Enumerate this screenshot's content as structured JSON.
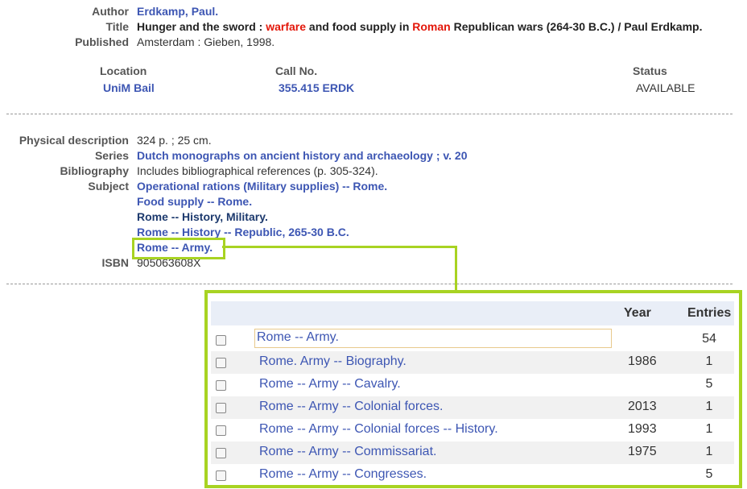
{
  "record": {
    "author_label": "Author",
    "author": "Erdkamp, Paul.",
    "title_label": "Title",
    "title_pre": "Hunger and the sword : ",
    "title_hl1": "warfare",
    "title_mid": " and food supply in ",
    "title_hl2": "Roman",
    "title_post": " Republican wars (264-30 B.C.) / Paul Erdkamp.",
    "published_label": "Published",
    "published": "Amsterdam : Gieben, 1998."
  },
  "holdings": {
    "location_header": "Location",
    "callno_header": "Call No.",
    "status_header": "Status",
    "location": "UniM Bail",
    "callno": "355.415 ERDK",
    "status": "AVAILABLE"
  },
  "details": {
    "physical_label": "Physical description",
    "physical": "324 p. ; 25 cm.",
    "series_label": "Series",
    "series": "Dutch monographs on ancient history and archaeology ; v. 20",
    "bibliography_label": "Bibliography",
    "bibliography": "Includes bibliographical references (p. 305-324).",
    "subject_label": "Subject",
    "subjects": [
      "Operational rations (Military supplies) -- Rome.",
      "Food supply -- Rome.",
      "Rome -- History, Military.",
      "Rome -- History -- Republic, 265-30 B.C.",
      "Rome -- Army."
    ],
    "isbn_label": "ISBN",
    "isbn": "905063608X"
  },
  "browse": {
    "year_header": "Year",
    "entries_header": "Entries",
    "rows": [
      {
        "text": "Rome -- Army.",
        "year": "",
        "entries": "54"
      },
      {
        "text": "Rome. Army -- Biography.",
        "year": "1986",
        "entries": "1"
      },
      {
        "text": "Rome -- Army -- Cavalry.",
        "year": "",
        "entries": "5"
      },
      {
        "text": "Rome -- Army -- Colonial forces.",
        "year": "2013",
        "entries": "1"
      },
      {
        "text": "Rome -- Army -- Colonial forces -- History.",
        "year": "1993",
        "entries": "1"
      },
      {
        "text": "Rome -- Army -- Commissariat.",
        "year": "1975",
        "entries": "1"
      },
      {
        "text": "Rome -- Army -- Congresses.",
        "year": "",
        "entries": "5"
      }
    ]
  },
  "colors": {
    "link": "#3d56b3",
    "highlight_term": "#e3170a",
    "callout": "#a8d322"
  }
}
